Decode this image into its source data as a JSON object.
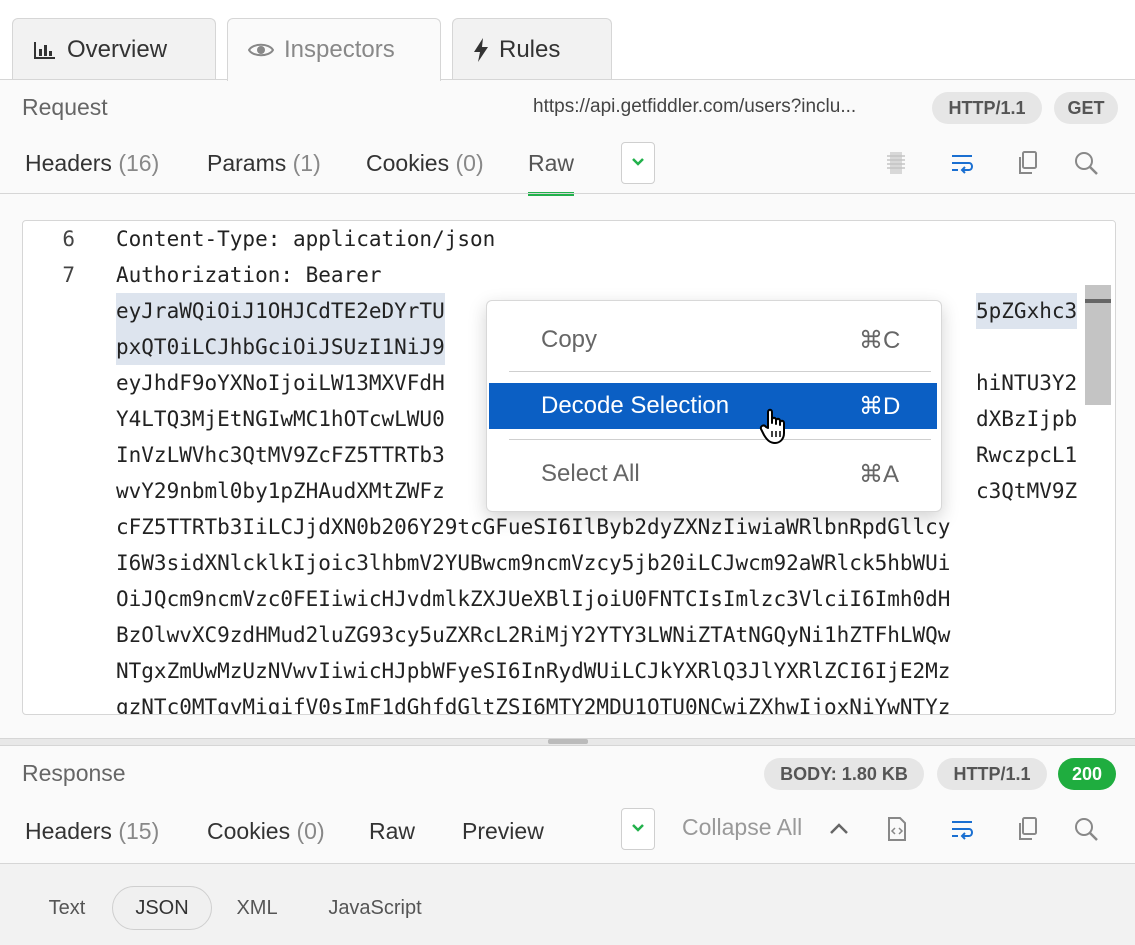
{
  "top_tabs": [
    {
      "label": "Overview",
      "icon": "bar-chart-icon",
      "active": false
    },
    {
      "label": "Inspectors",
      "icon": "eye-icon",
      "active": true
    },
    {
      "label": "Rules",
      "icon": "lightning-icon",
      "active": false
    }
  ],
  "request": {
    "label": "Request",
    "url": "https://api.getfiddler.com/users?inclu...",
    "protocol": "HTTP/1.1",
    "method": "GET",
    "tabs": [
      {
        "label": "Headers",
        "count": "(16)"
      },
      {
        "label": "Params",
        "count": "(1)"
      },
      {
        "label": "Cookies",
        "count": "(0)"
      },
      {
        "label": "Raw",
        "count": ""
      }
    ],
    "active_tab": "Raw",
    "code_lines": [
      {
        "num": "6",
        "text": "Content-Type: application/json"
      },
      {
        "num": "7",
        "text": "Authorization: Bearer"
      },
      {
        "num": "",
        "text": "eyJraWQiOiJ1OHJCdTE2eDYrTU"
      },
      {
        "num": "",
        "text": "pxQT0iLCJhbGciOiJSUzI1NiJ9"
      },
      {
        "num": "",
        "text": "eyJhdF9oYXNoIjoiLW13MXVFdH"
      },
      {
        "num": "",
        "text": "Y4LTQ3MjEtNGIwMC1hOTcwLWU0"
      },
      {
        "num": "",
        "text": "InVzLWVhc3QtMV9ZcFZ5TTRTb3"
      },
      {
        "num": "",
        "text": "wvY29nbml0by1pZHAudXMtZWFz"
      },
      {
        "num": "",
        "text": "cFZ5TTRTb3IiLCJjdXN0b206Y29tcGFueSI6IlByb2dyZXNzIiwiaWRlbnRpdGllcy"
      },
      {
        "num": "",
        "text": "I6W3sidXNlcklkIjoic3lhbmV2YUBwcm9ncmVzcy5jb20iLCJwcm92aWRlck5hbWUi"
      },
      {
        "num": "",
        "text": "OiJQcm9ncmVzc0FEIiwicHJvdmlkZXJUeXBlIjoiU0FNTCIsImlzc3VlciI6Imh0dH"
      },
      {
        "num": "",
        "text": "BzOlwvXC9zdHMud2luZG93cy5uZXRcL2RiMjY2YTY3LWNiZTAtNGQyNi1hZTFhLWQw"
      },
      {
        "num": "",
        "text": "NTgxZmUwMzUzNVwvIiwicHJpbWFyeSI6InRydWUiLCJkYXRlQ3JlYXRlZCI6IjE2Mz"
      },
      {
        "num": "",
        "text": "gzNTc0MTgyMigifV0sImF1dGhfdGltZSI6MTY2MDU1OTU0NCwiZXhwIjoxNiYwNTYz"
      }
    ],
    "code_right_fragments": [
      {
        "row": 2,
        "text": "5pZGxhc3"
      },
      {
        "row": 4,
        "text": "hiNTU3Y2"
      },
      {
        "row": 5,
        "text": "dXBzIjpb"
      },
      {
        "row": 6,
        "text": "RwczpcL1"
      },
      {
        "row": 7,
        "text": "c3QtMV9Z"
      }
    ]
  },
  "context_menu": {
    "items": [
      {
        "label": "Copy",
        "shortcut": "⌘C",
        "highlighted": false
      },
      {
        "label": "Decode Selection",
        "shortcut": "⌘D",
        "highlighted": true
      },
      {
        "label": "Select All",
        "shortcut": "⌘A",
        "highlighted": false
      }
    ]
  },
  "response": {
    "label": "Response",
    "body_size": "BODY: 1.80 KB",
    "protocol": "HTTP/1.1",
    "status": "200",
    "tabs": [
      {
        "label": "Headers",
        "count": "(15)"
      },
      {
        "label": "Cookies",
        "count": "(0)"
      },
      {
        "label": "Raw",
        "count": ""
      },
      {
        "label": "Preview",
        "count": ""
      }
    ],
    "collapse_all": "Collapse All",
    "view_tabs": [
      "Text",
      "JSON",
      "XML",
      "JavaScript"
    ],
    "active_view": "JSON"
  },
  "colors": {
    "accent_green": "#22b14c",
    "status_green": "#1fad3f",
    "menu_highlight": "#0b5fc4",
    "icon_blue": "#1a6fd1"
  }
}
